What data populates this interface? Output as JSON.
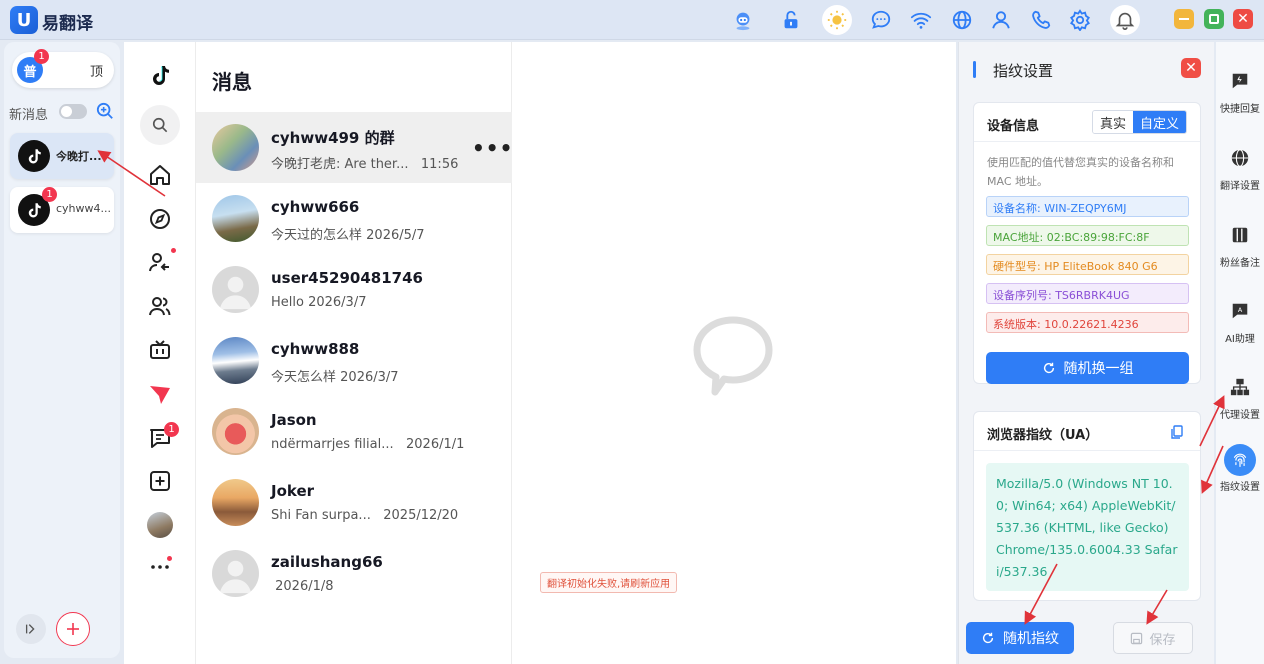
{
  "app": {
    "title": "易翻译",
    "logo": "U"
  },
  "titlebar_icons": [
    "robot-icon",
    "unlock-icon",
    "sun-icon",
    "chat-icon",
    "wifi-icon",
    "globe-icon",
    "user-icon",
    "phone-icon",
    "gear-icon",
    "bell-icon"
  ],
  "left_panel": {
    "mode_normal": "普",
    "mode_normal_badge": "1",
    "mode_top": "顶",
    "new_message_label": "新消息",
    "sessions": [
      {
        "name": "今晚打...",
        "badge": "",
        "active": true
      },
      {
        "name": "cyhww4...",
        "badge": "1",
        "active": false
      }
    ]
  },
  "rail": {
    "message_badge": "1"
  },
  "messages": {
    "title": "消息",
    "conversations": [
      {
        "name": "cyhww499 的群",
        "preview": "今晚打老虎: Are ther...",
        "time": "11:56",
        "active": true
      },
      {
        "name": "cyhww666",
        "preview": "今天过的怎么样",
        "time": "2026/5/7"
      },
      {
        "name": "user45290481746",
        "preview": "Hello",
        "time": "2026/3/7"
      },
      {
        "name": "cyhww888",
        "preview": "今天怎么样",
        "time": "2026/3/7"
      },
      {
        "name": "Jason",
        "preview": "ndërmarrjes filial...",
        "time": "2026/1/1"
      },
      {
        "name": "Joker",
        "preview": "Shi Fan surpa...",
        "time": "2025/12/20"
      },
      {
        "name": "zailushang66",
        "preview": "",
        "time": "2026/1/8"
      }
    ]
  },
  "chat": {
    "error": "翻译初始化失败,请刷新应用"
  },
  "fingerprint": {
    "title": "指纹设置",
    "device_info_title": "设备信息",
    "seg_real": "真实",
    "seg_custom": "自定义",
    "description": "使用匹配的值代替您真实的设备名称和 MAC 地址。",
    "fields": [
      {
        "text": "设备名称: WIN-ZEQPY6MJ",
        "color": "#2f7df6",
        "bg": "#e8f1fd",
        "border": "#b9d3f8"
      },
      {
        "text": "MAC地址: 02:BC:89:98:FC:8F",
        "color": "#4aa43a",
        "bg": "#eef8ea",
        "border": "#bfe3b3"
      },
      {
        "text": "硬件型号: HP EliteBook 840 G6",
        "color": "#e38a1f",
        "bg": "#fdf4e6",
        "border": "#f3d3a0"
      },
      {
        "text": "设备序列号: TS6RBRK4UG",
        "color": "#8a4fd6",
        "bg": "#f3ecfc",
        "border": "#d6c1f3"
      },
      {
        "text": "系统版本: 10.0.22621.4236",
        "color": "#e0453c",
        "bg": "#fdeceb",
        "border": "#f3bbb7"
      }
    ],
    "random_group_button": "随机换一组",
    "ua_title": "浏览器指纹（UA）",
    "ua_value": "Mozilla/5.0 (Windows NT 10.0; Win64; x64) AppleWebKit/537.36 (KHTML, like Gecko) Chrome/135.0.6004.33 Safari/537.36",
    "random_fingerprint_button": "随机指纹",
    "save_button": "保存"
  },
  "right_bar": {
    "items": [
      {
        "label": "快捷回复",
        "icon": "quick-reply-icon"
      },
      {
        "label": "翻译设置",
        "icon": "globe-icon"
      },
      {
        "label": "粉丝备注",
        "icon": "notes-icon"
      },
      {
        "label": "AI助理",
        "icon": "ai-icon"
      },
      {
        "label": "代理设置",
        "icon": "proxy-icon"
      },
      {
        "label": "指纹设置",
        "icon": "fingerprint-icon"
      }
    ]
  },
  "colors": {
    "accent": "#2f7df6",
    "badge": "#f2364f",
    "annotation": "#e0333a"
  }
}
